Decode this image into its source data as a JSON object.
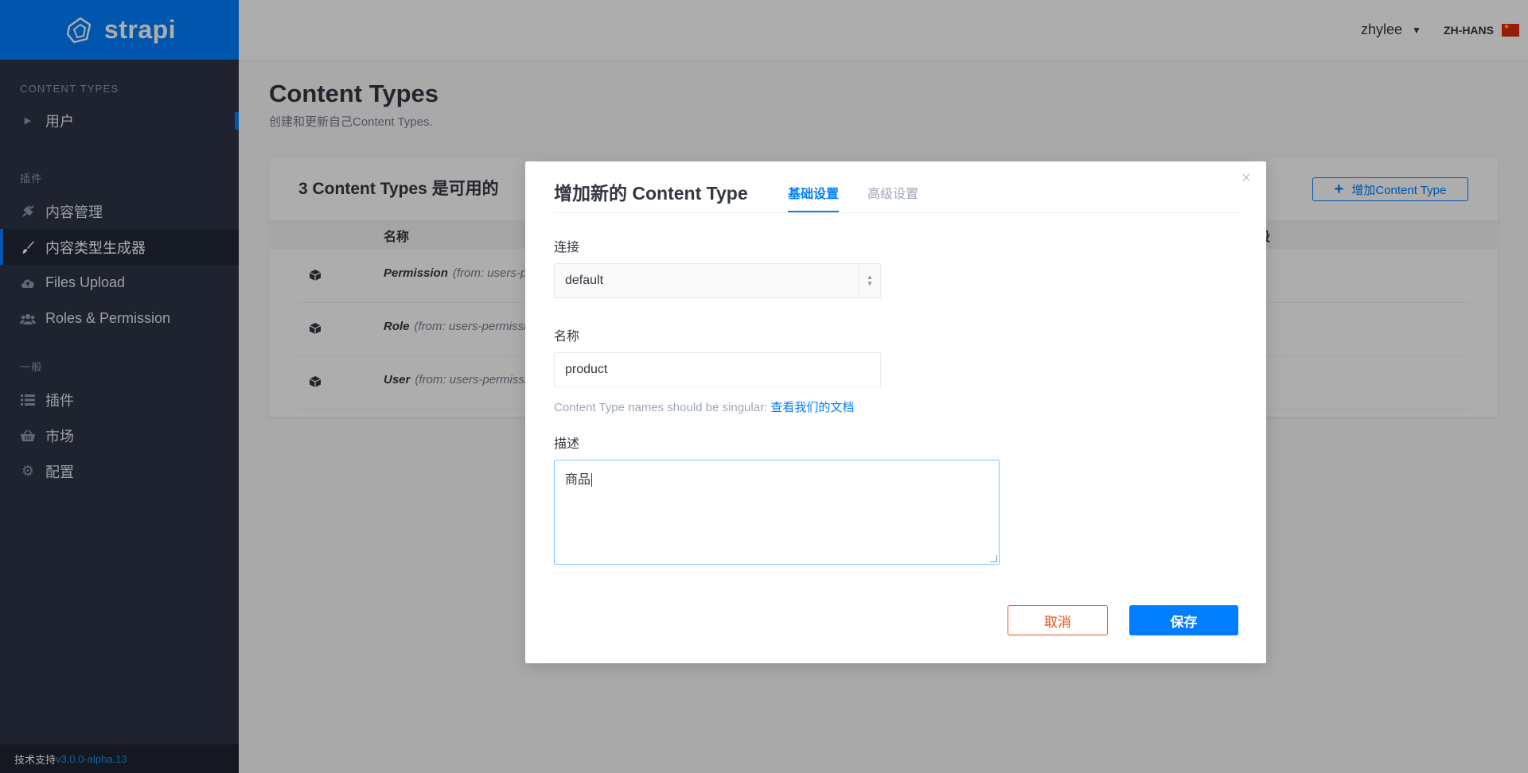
{
  "sidebar": {
    "brand": "strapi",
    "section_content_types": "CONTENT TYPES",
    "content_types": [
      {
        "label": "用户"
      }
    ],
    "section_plugins": "插件",
    "plugins": [
      {
        "label": "内容管理",
        "icon": "plug-icon"
      },
      {
        "label": "内容类型生成器",
        "icon": "paint-brush-icon"
      },
      {
        "label": "Files Upload",
        "icon": "cloud-upload-icon"
      },
      {
        "label": "Roles & Permission",
        "icon": "users-icon"
      }
    ],
    "section_general": "一般",
    "general": [
      {
        "label": "插件",
        "icon": "list-icon"
      },
      {
        "label": "市场",
        "icon": "basket-icon"
      },
      {
        "label": "配置",
        "icon": "gear-icon"
      }
    ],
    "footer_prefix": "技术支持",
    "footer_version": "v3.0.0-alpha.13"
  },
  "header": {
    "username": "zhylee",
    "language": "ZH-HANS"
  },
  "main": {
    "title": "Content Types",
    "description": "创建和更新自己Content Types.",
    "card_title": "3 Content Types 是可用的",
    "add_button": "增加Content Type",
    "col_name": "名称",
    "col_right": "段",
    "rows": [
      {
        "name": "Permission",
        "source": "(from: users-perm"
      },
      {
        "name": "Role",
        "source": "(from: users-permissions"
      },
      {
        "name": "User",
        "source": "(from: users-permissions"
      }
    ]
  },
  "modal": {
    "title": "增加新的 Content Type",
    "tabs": [
      {
        "label": "基础设置"
      },
      {
        "label": "高级设置"
      }
    ],
    "close": "×",
    "connection_label": "连接",
    "connection_value": "default",
    "name_label": "名称",
    "name_value": "product",
    "hint_text": "Content Type names should be singular: ",
    "hint_link": "查看我们的文档",
    "description_label": "描述",
    "description_value": "商品",
    "cancel_label": "取消",
    "save_label": "保存"
  },
  "colors": {
    "accent": "#007eff",
    "sidebar_bg": "#2e3446",
    "cancel": "#f64d0a"
  }
}
